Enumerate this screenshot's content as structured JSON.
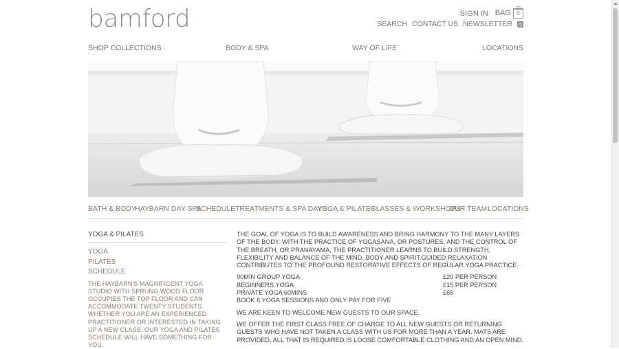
{
  "brand": {
    "logo": "bamford"
  },
  "utility": {
    "sign_in": "SIGN IN",
    "bag": "BAG",
    "bag_count": "0",
    "search": "SEARCH",
    "contact": "CONTACT US",
    "newsletter": "NEWSLETTER"
  },
  "main_nav": [
    "SHOP COLLECTIONS",
    "BODY & SPA",
    "WAY OF LIFE",
    "LOCATIONS"
  ],
  "sub_nav": [
    "BATH & BODY",
    "HAYBARN DAY SPA",
    "SCHEDULE",
    "TREATMENTS & SPA DAYS",
    "YOGA & PILATES",
    "CLASSES & WORKSHOPS",
    "OUR TEAM",
    "LOCATIONS"
  ],
  "sidebar": {
    "title": "YOGA & PILATES",
    "links": [
      "YOGA",
      "PILATES",
      "SCHEDULE"
    ],
    "text": "THE HAYBARN'S MAGNIFICENT YOGA STUDIO WITH SPRUNG WOOD FLOOR OCCUPIES THE TOP FLOOR AND CAN ACCOMMODATE TWENTY STUDENTS. WHETHER YOU ARE AN EXPERIENCED PRACTITIONER OR INTERESTED IN TAKING UP A NEW CLASS, OUR YOGA AND PILATES SCHEDULE WILL HAVE SOMETHING FOR YOU."
  },
  "content": {
    "intro": "THE GOAL OF YOGA IS TO BUILD AWARENESS AND BRING HARMONY TO THE MANY LAYERS OF THE BODY. WITH THE PRACTICE OF YOGASANA, OR POSTURES, AND THE CONTROL OF THE BREATH, OR PRANAYAMA, THE PRACTITIONER LEARNS TO BUILD STRENGTH, FLEXIBILITY AND BALANCE OF THE MIND, BODY AND SPIRIT.GUIDED RELAXATION CONTRIBUTES TO THE PROFOUND RESTORATIVE EFFECTS OF REGULAR YOGA PRACTICE.",
    "prices": [
      {
        "name": "90MIN GROUP YOGA",
        "price": "£20 PER PERSON"
      },
      {
        "name": "BEGINNERS YOGA",
        "price": "£15 PER PERSON"
      },
      {
        "name": "PRIVATE YOGA 60MINS",
        "price": "£65"
      }
    ],
    "offer": "BOOK 6 YOGA SESSIONS AND ONLY PAY FOR FIVE",
    "welcome": "WE ARE KEEN TO WELCOME NEW GUESTS TO OUR SPACE.",
    "free_class": "WE OFFER THE FIRST CLASS FREE OF CHARGE TO ALL NEW GUESTS OR RETURNING GUESTS WHO HAVE NOT TAKEN A CLASS WITH US FOR MORE THAN A YEAR. MATS ARE PROVIDED, ALL THAT IS REQUIRED IS LOOSE COMFORTABLE CLOTHING AND AN OPEN MIND."
  }
}
